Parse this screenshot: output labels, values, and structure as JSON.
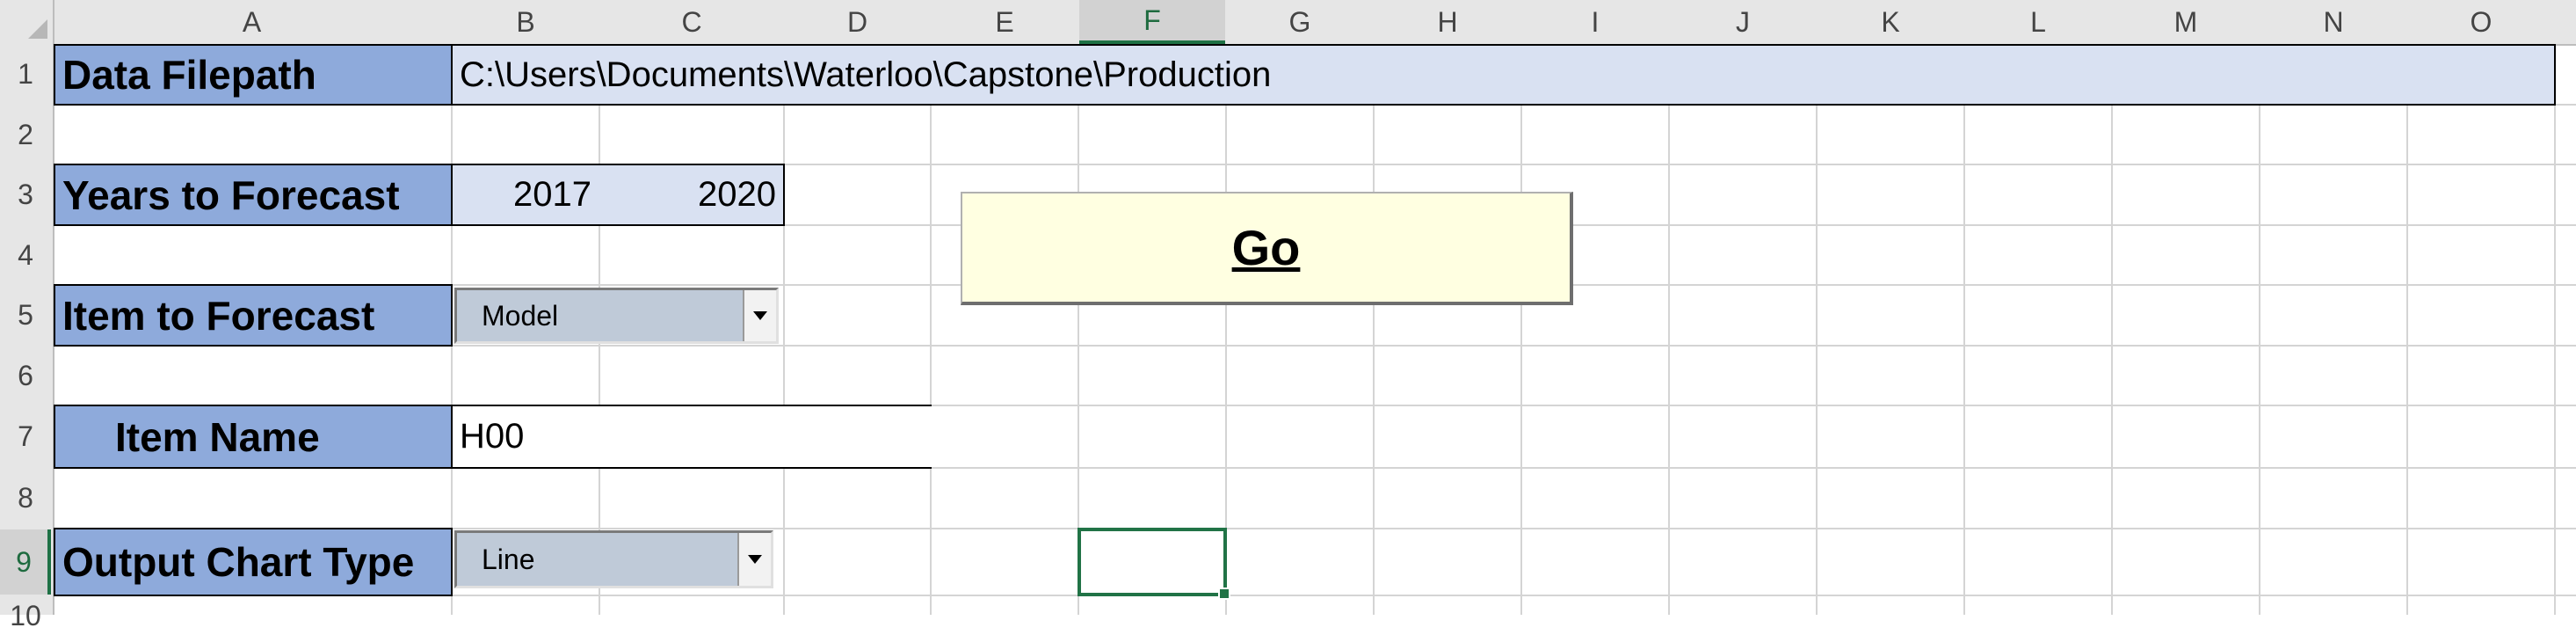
{
  "columns": [
    "A",
    "B",
    "C",
    "D",
    "E",
    "F",
    "G",
    "H",
    "I",
    "J",
    "K",
    "L",
    "M",
    "N",
    "O"
  ],
  "active_column": "F",
  "rows": [
    "1",
    "2",
    "3",
    "4",
    "5",
    "6",
    "7",
    "8",
    "9",
    "10"
  ],
  "active_row": "9",
  "cells": {
    "data_filepath_label": "Data Filepath",
    "data_filepath_value": "C:\\Users\\Documents\\Waterloo\\Capstone\\Production",
    "years_label": "Years to Forecast",
    "year_start": "2017",
    "year_end": "2020",
    "item_to_forecast_label": "Item to Forecast",
    "item_to_forecast_value": "Model",
    "item_name_label": "Item Name",
    "item_name_value": "H00",
    "output_chart_type_label": "Output Chart Type",
    "output_chart_type_value": "Line"
  },
  "go_button": {
    "label": "Go"
  },
  "colors": {
    "label_fill": "#8eaadb",
    "value_fill": "#d9e1f2",
    "combo_fill": "#bfcad8",
    "go_fill": "#ffffe1",
    "selection": "#217346"
  }
}
